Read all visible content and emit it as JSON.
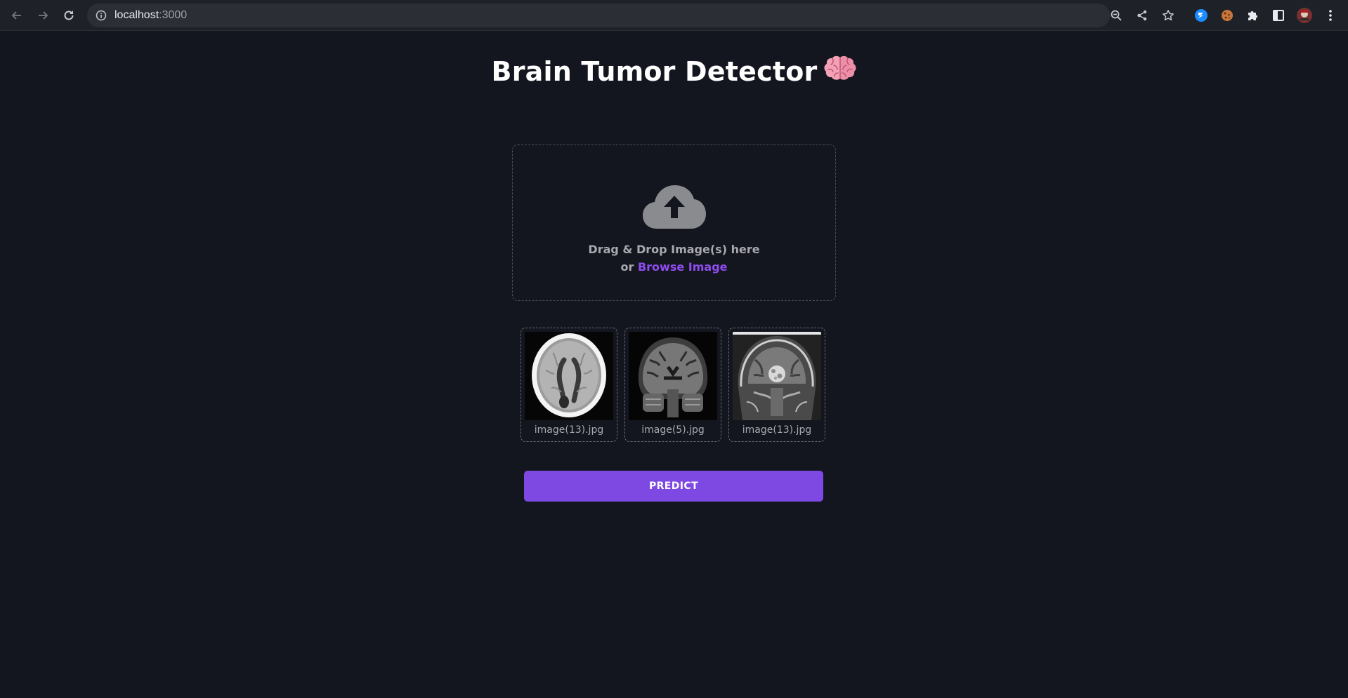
{
  "browser": {
    "url_host": "localhost",
    "url_port": ":3000",
    "icons": [
      "back-icon",
      "forward-icon",
      "reload-icon",
      "info-icon",
      "zoom-icon",
      "share-icon",
      "bookmark-star-icon",
      "extension-blue-icon",
      "cookie-icon",
      "puzzle-icon",
      "side-panel-icon",
      "profile-avatar",
      "menu-dots-icon"
    ]
  },
  "page": {
    "title": "Brain Tumor Detector",
    "title_emoji": "brain-icon"
  },
  "dropzone": {
    "line1": "Drag & Drop Image(s) here",
    "or_text": "or",
    "browse_label": "Browse Image",
    "icon": "cloud-upload-icon"
  },
  "thumbnails": [
    {
      "filename": "image(13).jpg"
    },
    {
      "filename": "image(5).jpg"
    },
    {
      "filename": "image(13).jpg"
    }
  ],
  "predict_label": "PREDICT",
  "colors": {
    "background": "#14161f",
    "accent": "#7e48e3",
    "link": "#8f4cf0",
    "muted_text": "#a8a9ae"
  }
}
